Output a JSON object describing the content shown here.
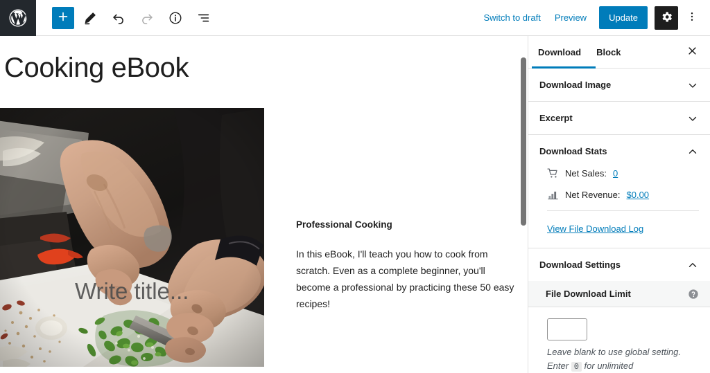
{
  "toolbar": {
    "logo_icon": "wordpress-logo-icon",
    "add_block_label": "+",
    "add_block_icon": "plus-icon",
    "tools_icon": "pencil-icon",
    "undo_icon": "undo-icon",
    "redo_icon": "redo-icon",
    "details_icon": "info-circle-icon",
    "list_view_icon": "list-view-icon",
    "switch_to_draft": "Switch to draft",
    "preview": "Preview",
    "update": "Update",
    "settings_icon": "gear-icon",
    "options_icon": "more-vertical-icon",
    "accent_color": "#007cba",
    "dark_color": "#1e1e1e"
  },
  "editor": {
    "post_title": "Cooking eBook",
    "cover_block": {
      "placeholder": "Write title...",
      "image_alt": "person chopping green chilies on a white cutting board"
    },
    "text_block": {
      "heading": "Professional Cooking",
      "body": "In this eBook, I'll teach you how to cook from scratch. Even as a complete beginner, you'll become a professional by practicing these 50 easy recipes!"
    }
  },
  "sidebar": {
    "tabs": [
      {
        "label": "Download",
        "active": true
      },
      {
        "label": "Block",
        "active": false
      }
    ],
    "close_icon": "close-icon",
    "panels": [
      {
        "title": "Download Image",
        "expanded": false,
        "icon": "chevron-down-icon"
      },
      {
        "title": "Excerpt",
        "expanded": false,
        "icon": "chevron-down-icon"
      }
    ],
    "download_stats": {
      "title": "Download Stats",
      "toggle_icon": "chevron-up-icon",
      "rows": [
        {
          "icon": "cart-icon",
          "label": "Net Sales:",
          "value": "0"
        },
        {
          "icon": "chart-icon",
          "label": "Net Revenue:",
          "value": "$0.00"
        }
      ],
      "log_link": "View File Download Log"
    },
    "download_settings": {
      "title": "Download Settings",
      "toggle_icon": "chevron-up-icon",
      "file_download_limit": {
        "label": "File Download Limit",
        "help_icon": "help-circle-icon",
        "value": "",
        "placeholder": "",
        "hint_line1": "Leave blank to use global setting.",
        "hint_enter": "Enter",
        "hint_code": "0",
        "hint_line2": "for unlimited"
      }
    }
  }
}
